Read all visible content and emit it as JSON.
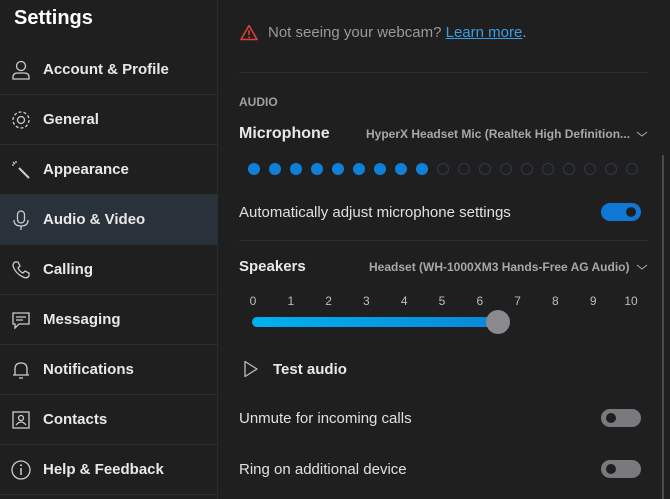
{
  "sidebar": {
    "title": "Settings",
    "items": [
      {
        "label": "Account & Profile",
        "icon": "person-icon"
      },
      {
        "label": "General",
        "icon": "gear-icon"
      },
      {
        "label": "Appearance",
        "icon": "magic-wand-icon"
      },
      {
        "label": "Audio & Video",
        "icon": "microphone-icon",
        "active": true
      },
      {
        "label": "Calling",
        "icon": "phone-icon"
      },
      {
        "label": "Messaging",
        "icon": "chat-icon"
      },
      {
        "label": "Notifications",
        "icon": "bell-icon"
      },
      {
        "label": "Contacts",
        "icon": "contact-card-icon"
      },
      {
        "label": "Help & Feedback",
        "icon": "info-icon"
      }
    ]
  },
  "main": {
    "webcam_warning": "Not seeing your webcam?",
    "learn_more": "Learn more",
    "period": ".",
    "audio_heading": "AUDIO",
    "microphone": {
      "label": "Microphone",
      "device": "HyperX Headset Mic (Realtek High Definition...",
      "level_filled": 9,
      "level_total": 19
    },
    "auto_adjust": {
      "label": "Automatically adjust microphone settings",
      "on": true
    },
    "speakers": {
      "label": "Speakers",
      "device": "Headset (WH-1000XM3 Hands-Free AG Audio)",
      "ticks": [
        "0",
        "1",
        "2",
        "3",
        "4",
        "5",
        "6",
        "7",
        "8",
        "9",
        "10"
      ],
      "volume": 6.5
    },
    "test_audio": "Test audio",
    "unmute": {
      "label": "Unmute for incoming calls",
      "on": false
    },
    "ring": {
      "label": "Ring on additional device",
      "on": false
    },
    "colors": {
      "accent": "#0f78d4",
      "warning": "#e0413a",
      "link": "#3a9ee6"
    }
  }
}
